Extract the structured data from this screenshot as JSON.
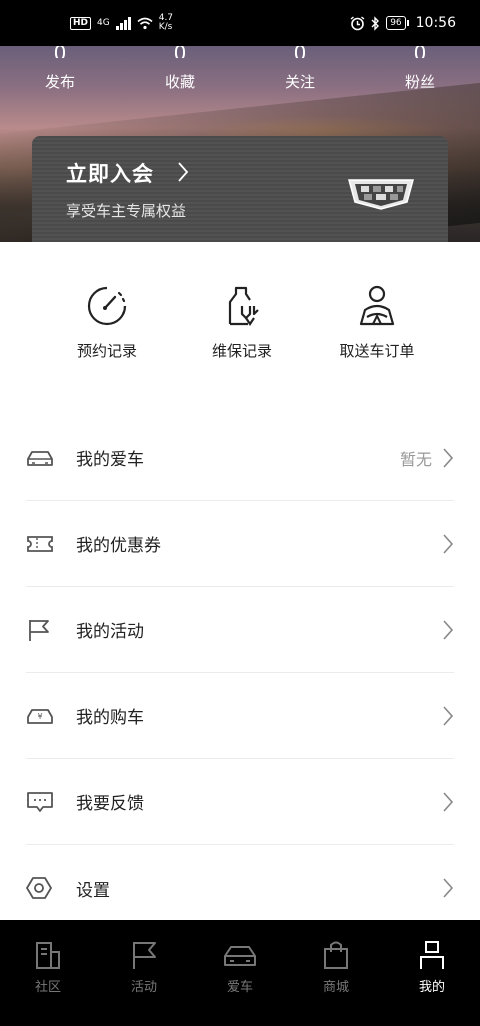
{
  "status_bar": {
    "hd": "HD",
    "network": "4G",
    "speed_value": "4.7",
    "speed_unit": "K/s",
    "battery": "96",
    "time": "10:56"
  },
  "stats": [
    {
      "value": "0",
      "label": "发布"
    },
    {
      "value": "0",
      "label": "收藏"
    },
    {
      "value": "0",
      "label": "关注"
    },
    {
      "value": "0",
      "label": "粉丝"
    }
  ],
  "vip": {
    "title": "立即入会",
    "subtitle": "享受车主专属权益",
    "logo_icon": "cadillac-crest-icon"
  },
  "quick_actions": [
    {
      "label": "预约记录",
      "icon": "speedometer-icon"
    },
    {
      "label": "维保记录",
      "icon": "maintenance-bottle-icon"
    },
    {
      "label": "取送车订单",
      "icon": "driver-icon"
    }
  ],
  "menu": [
    {
      "label": "我的爱车",
      "value": "暂无",
      "icon": "car-icon"
    },
    {
      "label": "我的优惠券",
      "value": "",
      "icon": "ticket-icon"
    },
    {
      "label": "我的活动",
      "value": "",
      "icon": "flag-icon"
    },
    {
      "label": "我的购车",
      "value": "",
      "icon": "car-purchase-icon"
    },
    {
      "label": "我要反馈",
      "value": "",
      "icon": "chat-bubble-icon"
    },
    {
      "label": "设置",
      "value": "",
      "icon": "hexagon-nut-icon"
    }
  ],
  "tabs": [
    {
      "label": "社区",
      "icon": "community-icon",
      "active": false
    },
    {
      "label": "活动",
      "icon": "flag-icon",
      "active": false
    },
    {
      "label": "爱车",
      "icon": "car-icon",
      "active": false
    },
    {
      "label": "商城",
      "icon": "shopping-bag-icon",
      "active": false
    },
    {
      "label": "我的",
      "icon": "person-icon",
      "active": true
    }
  ],
  "colors": {
    "tab_bar_bg": "#000000",
    "tab_active": "#ffffff",
    "tab_inactive": "#777777",
    "vip_card": "#4d4d4d"
  }
}
